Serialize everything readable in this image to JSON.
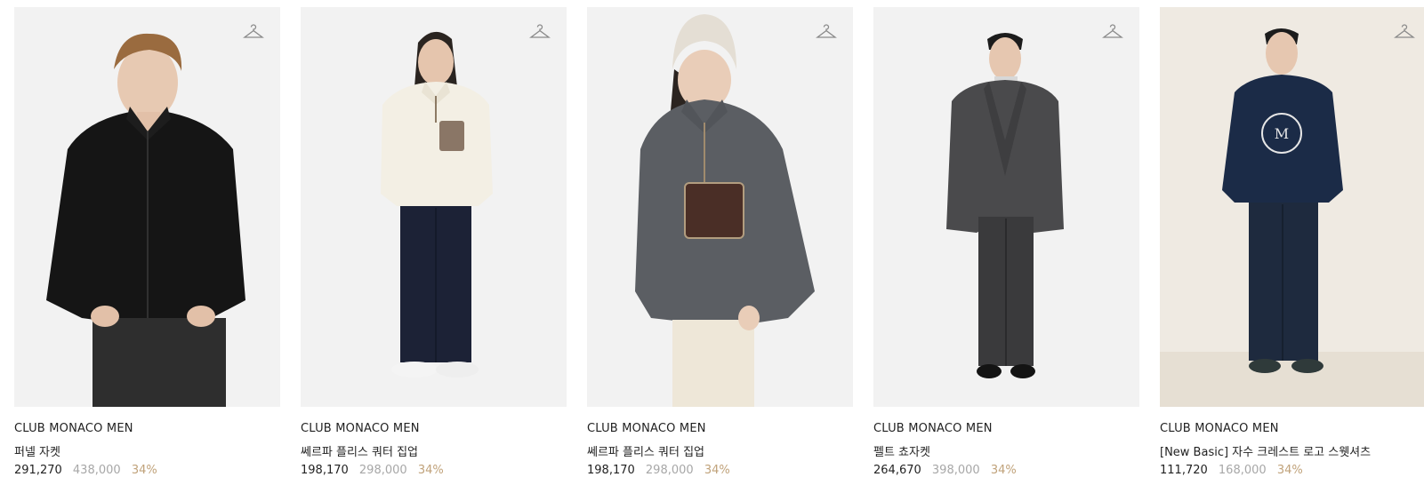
{
  "colors": {
    "discount": "#c0a27a",
    "original_price": "#a7a7a7",
    "text": "#222222",
    "photo_bg": "#f2f2f2"
  },
  "products": [
    {
      "brand": "CLUB MONACO MEN",
      "name": "퍼넬 자켓",
      "price": "291,270",
      "original_price": "438,000",
      "discount": "34%",
      "wishlist_icon": "hanger-icon"
    },
    {
      "brand": "CLUB MONACO MEN",
      "name": "쎄르파 플리스 쿼터 집업",
      "price": "198,170",
      "original_price": "298,000",
      "discount": "34%",
      "wishlist_icon": "hanger-icon"
    },
    {
      "brand": "CLUB MONACO MEN",
      "name": "쎄르파 플리스 쿼터 집업",
      "price": "198,170",
      "original_price": "298,000",
      "discount": "34%",
      "wishlist_icon": "hanger-icon"
    },
    {
      "brand": "CLUB MONACO MEN",
      "name": "펠트 쵸자켓",
      "price": "264,670",
      "original_price": "398,000",
      "discount": "34%",
      "wishlist_icon": "hanger-icon"
    },
    {
      "brand": "CLUB MONACO MEN",
      "name": "[New Basic] 자수 크레스트 로고 스웻셔츠",
      "price": "111,720",
      "original_price": "168,000",
      "discount": "34%",
      "wishlist_icon": "hanger-icon"
    }
  ]
}
